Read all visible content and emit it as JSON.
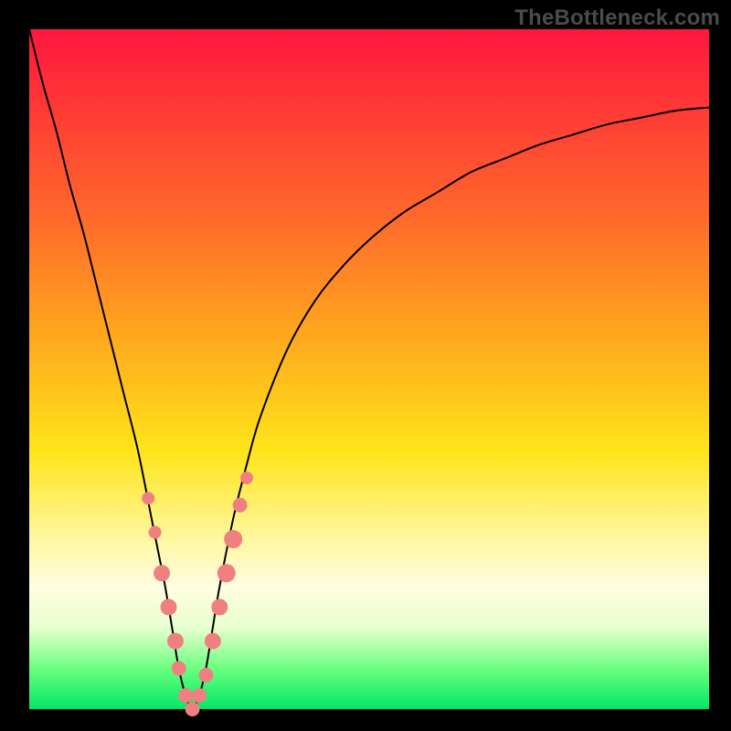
{
  "watermark": "TheBottleneck.com",
  "colors": {
    "frame": "#000000",
    "curve": "#000000",
    "markers": "#f08080",
    "gradient_stops": [
      {
        "pos": 0.0,
        "hex": "#ff163f"
      },
      {
        "pos": 0.12,
        "hex": "#ff3a35"
      },
      {
        "pos": 0.28,
        "hex": "#ff6a2b"
      },
      {
        "pos": 0.44,
        "hex": "#ffa41f"
      },
      {
        "pos": 0.62,
        "hex": "#ffe419"
      },
      {
        "pos": 0.75,
        "hex": "#fff7a0"
      },
      {
        "pos": 0.82,
        "hex": "#fffde0"
      },
      {
        "pos": 0.88,
        "hex": "#e8ffd0"
      },
      {
        "pos": 0.94,
        "hex": "#6cff80"
      },
      {
        "pos": 1.0,
        "hex": "#00e865"
      }
    ]
  },
  "chart_data": {
    "type": "line",
    "title": "",
    "xlabel": "",
    "ylabel": "",
    "xlim": [
      0,
      100
    ],
    "ylim": [
      0,
      100
    ],
    "grid": false,
    "legend": false,
    "x_min_at": 24,
    "series": [
      {
        "name": "bottleneck-curve",
        "x": [
          0,
          2,
          4,
          6,
          8,
          10,
          12,
          14,
          16,
          18,
          19,
          20,
          21,
          22,
          23,
          24,
          25,
          26,
          27,
          28,
          30,
          32,
          34,
          38,
          42,
          46,
          50,
          55,
          60,
          65,
          70,
          75,
          80,
          85,
          90,
          95,
          100
        ],
        "y": [
          100,
          92,
          85,
          77,
          70,
          62,
          54,
          46,
          38,
          28,
          23,
          18,
          12,
          6,
          2,
          0,
          2,
          6,
          12,
          18,
          28,
          36,
          43,
          53,
          60,
          65,
          69,
          73,
          76,
          79,
          81,
          83,
          84.5,
          86,
          87,
          88,
          88.5
        ]
      }
    ],
    "markers": {
      "name": "highlighted-points",
      "color": "#f08080",
      "x": [
        17.5,
        18.5,
        19.5,
        20.5,
        21.5,
        22.0,
        23.0,
        24.0,
        25.0,
        26.0,
        27.0,
        28.0,
        29.0,
        30.0,
        31.0,
        32.0
      ],
      "y": [
        31,
        26,
        20,
        15,
        10,
        6,
        2,
        0,
        2,
        5,
        10,
        15,
        20,
        25,
        30,
        34
      ],
      "r": [
        7,
        7,
        9,
        9,
        9,
        8,
        8,
        8,
        8,
        8,
        9,
        9,
        10,
        10,
        8,
        7
      ]
    }
  }
}
